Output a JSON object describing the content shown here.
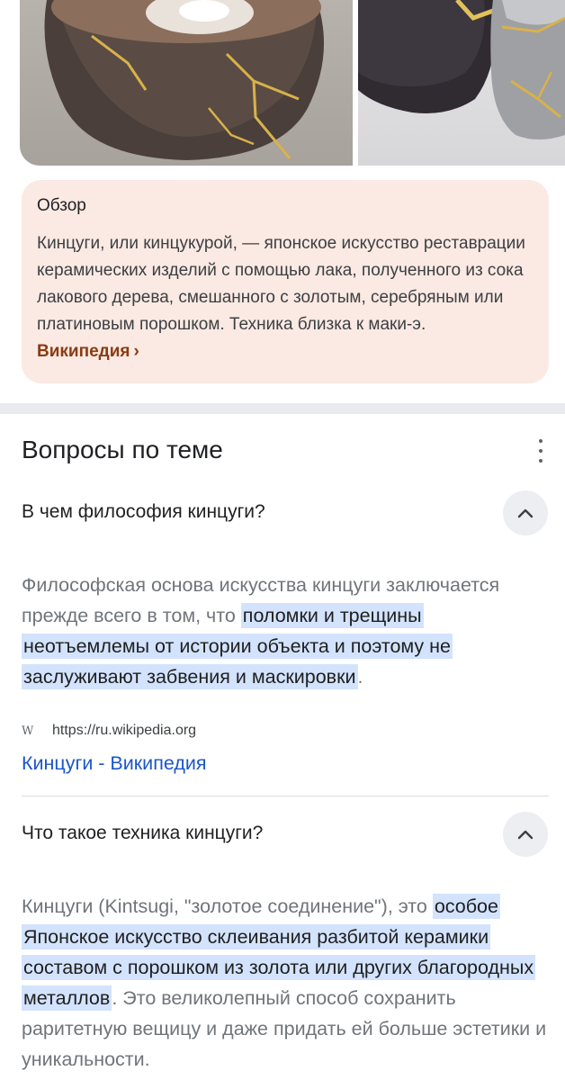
{
  "overview": {
    "title": "Обзор",
    "text": "Кинцуги, или кинцукурой, — японское искусство реставрации керамических изделий с помощью лака, полученного из сока лакового дерева, смешанного с золотым, серебряным или платиновым порошком. Техника близка к маки-э.",
    "source_link": "Википедия",
    "chevron": "›"
  },
  "paa": {
    "title": "Вопросы по теме",
    "items": [
      {
        "question": "В чем философия кинцуги?",
        "answer_pre": "Философская основа искусства кинцуги заключается прежде всего в том, что ",
        "answer_hl": "поломки и трещины неотъемлемы от истории объекта и поэтому не заслуживают забвения и маскировки",
        "answer_post": ".",
        "source_url": "https://ru.wikipedia.org",
        "source_icon": "W",
        "source_title": "Кинцуги - Википедия"
      },
      {
        "question": "Что такое техника кинцуги?",
        "answer_pre": "Кинцуги (Kintsugi, \"золотое соединение\"), это ",
        "answer_hl": "особое Японское искусство склеивания разбитой керамики составом с порошком из золота или других благородных металлов",
        "answer_post": ". Это великолепный способ сохранить раритетную вещицу и даже придать ей больше эстетики и уникальности."
      }
    ]
  },
  "colors": {
    "overview_bg": "#fbe9e3",
    "link_brown": "#8a3b12",
    "highlight": "#d3e3fd",
    "link_blue": "#1a56c8"
  }
}
